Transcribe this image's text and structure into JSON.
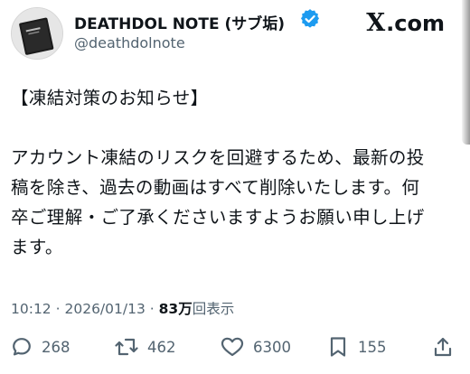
{
  "brand": {
    "x_label": "X",
    "suffix": ".com"
  },
  "author": {
    "display_name": "DEATHDOL NOTE (サブ垢)",
    "handle": "@deathdolnote",
    "verified": true,
    "avatar_icon": "black-notebook-icon"
  },
  "tweet": {
    "title": "【凍結対策のお知らせ】",
    "lines": [
      "アカウント凍結のリスクを回避するため、最新の投",
      "稿を除き、過去の動画はすべて削除いたします。何",
      "卒ご理解・ご了承くださいますようお願い申し上げ",
      "ます。"
    ]
  },
  "meta": {
    "time": "10:12",
    "date": "2026/01/13",
    "separator": "·",
    "views_count": "83万",
    "views_label": "回表示"
  },
  "actions": {
    "replies": "268",
    "reposts": "462",
    "likes": "6300",
    "bookmarks": "155"
  },
  "colors": {
    "text": "#0f1419",
    "secondary": "#536471",
    "verified": "#1d9bf0"
  }
}
